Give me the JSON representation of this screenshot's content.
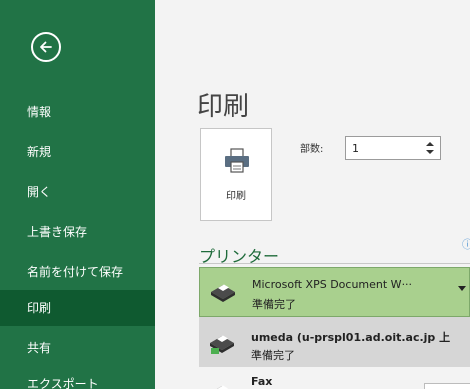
{
  "sidebar": {
    "back_icon": "back-arrow-icon",
    "items": [
      {
        "label": "情報"
      },
      {
        "label": "新規"
      },
      {
        "label": "開く"
      },
      {
        "label": "上書き保存"
      },
      {
        "label": "名前を付けて保存"
      },
      {
        "label": "印刷"
      },
      {
        "label": "共有"
      },
      {
        "label": "エクスポート"
      }
    ],
    "active_index": 5,
    "bg_color": "#217346",
    "active_color": "#0f5a30"
  },
  "main": {
    "title": "印刷",
    "print_button_label": "印刷",
    "copies_label": "部数:",
    "copies_value": "1",
    "printer_heading": "プリンター",
    "accent_color": "#1f6b3b"
  },
  "printers": {
    "selected": {
      "name": "Microsoft XPS Document W···",
      "status": "準備完了"
    },
    "list": [
      {
        "name": "umeda (u-prspl01.ad.oit.ac.jp 上",
        "status": "準備完了"
      },
      {
        "name": "Fax"
      }
    ]
  }
}
